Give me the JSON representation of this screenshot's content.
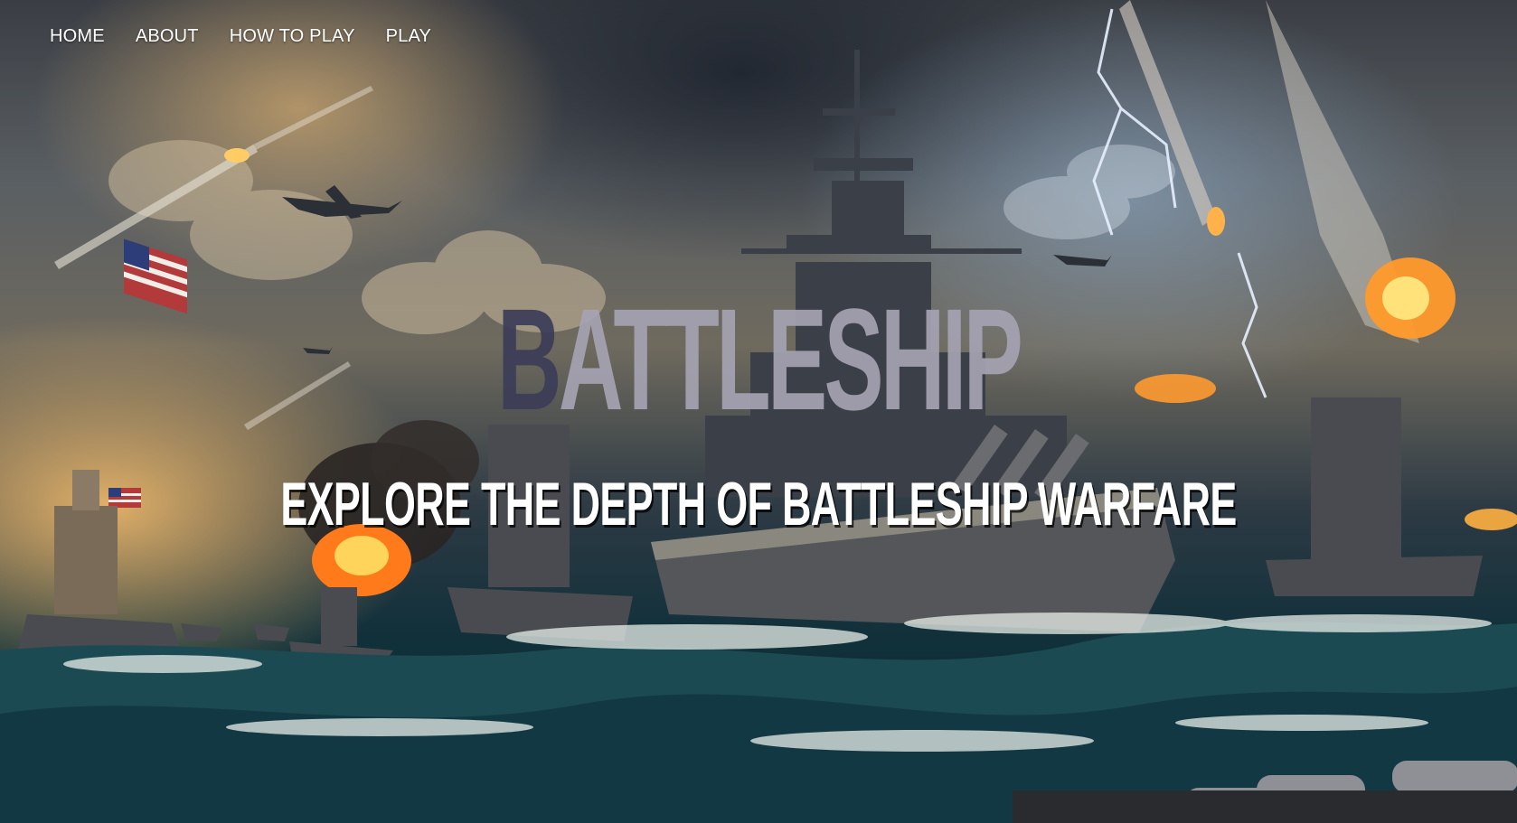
{
  "nav": {
    "items": [
      {
        "label": "HOME"
      },
      {
        "label": "ABOUT"
      },
      {
        "label": "HOW TO PLAY"
      },
      {
        "label": "PLAY"
      }
    ]
  },
  "hero": {
    "title_first_letter": "B",
    "title_rest": "ATTLESHIP",
    "subtitle": "EXPLORE THE DEPTH OF BATTLESHIP WARFARE",
    "background": "stormy-sea-battle-illustration"
  },
  "colors": {
    "nav_text": "#ffffff",
    "title": "#a6a3b3",
    "title_first_letter": "#3c3d58",
    "subtitle": "#ffffff"
  }
}
